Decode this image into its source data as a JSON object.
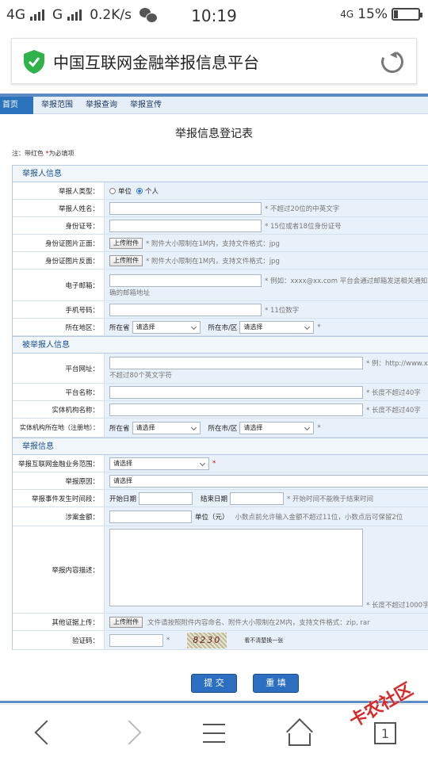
{
  "status": {
    "network1": "4G",
    "network2": "G",
    "speed": "0.2K/s",
    "time": "10:19",
    "network3": "4G",
    "battery": "15%",
    "battery_level": 0.15
  },
  "browser": {
    "page_title": "中国互联网金融举报信息平台",
    "watermark": "卡农社区",
    "tab_count": "1"
  },
  "nav": {
    "items": [
      "首页",
      "举报范围",
      "举报查询",
      "举报宣传"
    ]
  },
  "form": {
    "title": "举报信息登记表",
    "note": "注：带红色 *为必填项",
    "sections": {
      "reporter": "举报人信息",
      "reported": "被举报人信息",
      "report": "举报信息"
    },
    "reporter": {
      "type_label": "举报人类型：",
      "type_option1": "单位",
      "type_option2": "个人",
      "name_label": "举报人姓名：",
      "name_hint": "* 不超过20位的中英文字",
      "id_label": "身份证号：",
      "id_hint": "* 15位或者18位身份证号",
      "front_label": "身份证图片正面：",
      "back_label": "身份证图片反面：",
      "upload": "上传附件",
      "img_hint": "* 附件大小限制在1M内，支持文件格式：jpg",
      "email_label": "电子邮箱：",
      "email_hint": "*  例如：xxxx@xx.com 平台会通过邮箱发送相关通知",
      "email_hint2": "确的邮箱地址",
      "phone_label": "手机号码：",
      "phone_hint": "* 11位数字",
      "region_label": "所在地区：",
      "province": "所在省",
      "city": "所在市/区",
      "select": "请选择"
    },
    "reported": {
      "url_label": "平台网址：",
      "url_hint": "* 例：http://www.xx",
      "url_hint2": "不超过80个英文字符",
      "platform_label": "平台名称：",
      "len40": "* 长度不超过40字",
      "entity_label": "实体机构名称：",
      "entity_region_label": "实体机构所在地（注册地）："
    },
    "report": {
      "scope_label": "举报互联网金融业务范围：",
      "reason_label": "举报原因：",
      "time_label": "举报事件发生时间段：",
      "start": "开始日期",
      "end": "结束日期",
      "time_hint": "* 开始时间不能晚于结束时间",
      "amount_label": "涉案金额：",
      "unit": "单位（元）",
      "amount_hint": "小数点前允许输入金额不超过11位，小数点后可保留2位",
      "desc_label": "举报内容描述：",
      "desc_hint": "* 长度不超过1000字",
      "evidence_label": "其他证据上传：",
      "evidence_hint": "文件请按照附件内容命名、附件大小限制在2M内，支持文件格式：zip, rar",
      "captcha_label": "验证码：",
      "captcha_text": "8230",
      "captcha_hint": "看不清楚换一张"
    },
    "buttons": {
      "submit": "提 交",
      "reset": "重 填"
    }
  }
}
